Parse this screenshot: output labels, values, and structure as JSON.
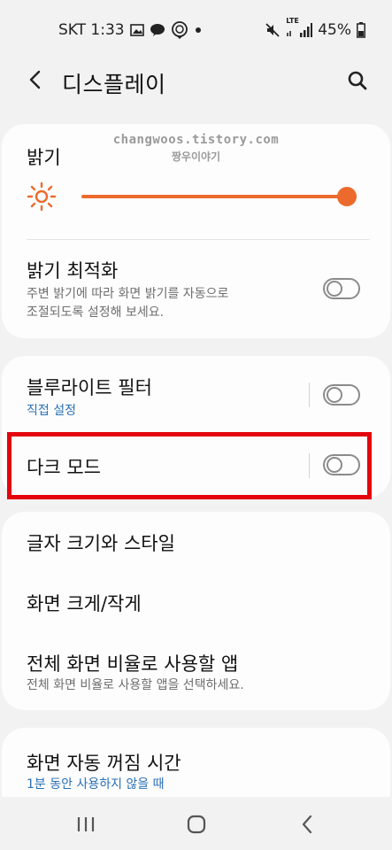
{
  "status": {
    "carrier_time": "SKT 1:33",
    "battery": "45%",
    "left_icons": [
      "gallery-icon",
      "talk-icon",
      "location-face-icon",
      "dot-icon"
    ],
    "right_icons": [
      "mute-icon",
      "lte-signal-icon",
      "battery-icon"
    ],
    "lte_label": "LTE"
  },
  "header": {
    "title": "디스플레이"
  },
  "watermark": {
    "line1": "changwoos.tistory.com",
    "line2": "짱우이야기"
  },
  "card1": {
    "brightness_label": "밝기",
    "brightness_level": 1.0,
    "adaptive_title": "밝기 최적화",
    "adaptive_desc_line1": "주변 밝기에 따라 화면 밝기를 자동으로",
    "adaptive_desc_line2": "조절되도록 설정해 보세요.",
    "adaptive_on": false
  },
  "card2": {
    "blue_light_title": "블루라이트 필터",
    "blue_light_sub": "직접 설정",
    "blue_light_on": false,
    "dark_mode_title": "다크 모드",
    "dark_mode_on": false
  },
  "card3": {
    "font_title": "글자 크기와 스타일",
    "zoom_title": "화면 크게/작게",
    "fullscreen_title": "전체 화면 비율로 사용할 앱",
    "fullscreen_desc": "전체 화면 비율로 사용할 앱을 선택하세요."
  },
  "card4": {
    "timeout_title": "화면 자동 꺼짐 시간",
    "timeout_sub": "1분 동안 사용하지 않을 때"
  },
  "colors": {
    "accent": "#ec6a2c",
    "link_blue": "#2a6fb5",
    "highlight_red": "#e3050c",
    "background": "#f2f2f2",
    "card": "#fdfdfd"
  }
}
